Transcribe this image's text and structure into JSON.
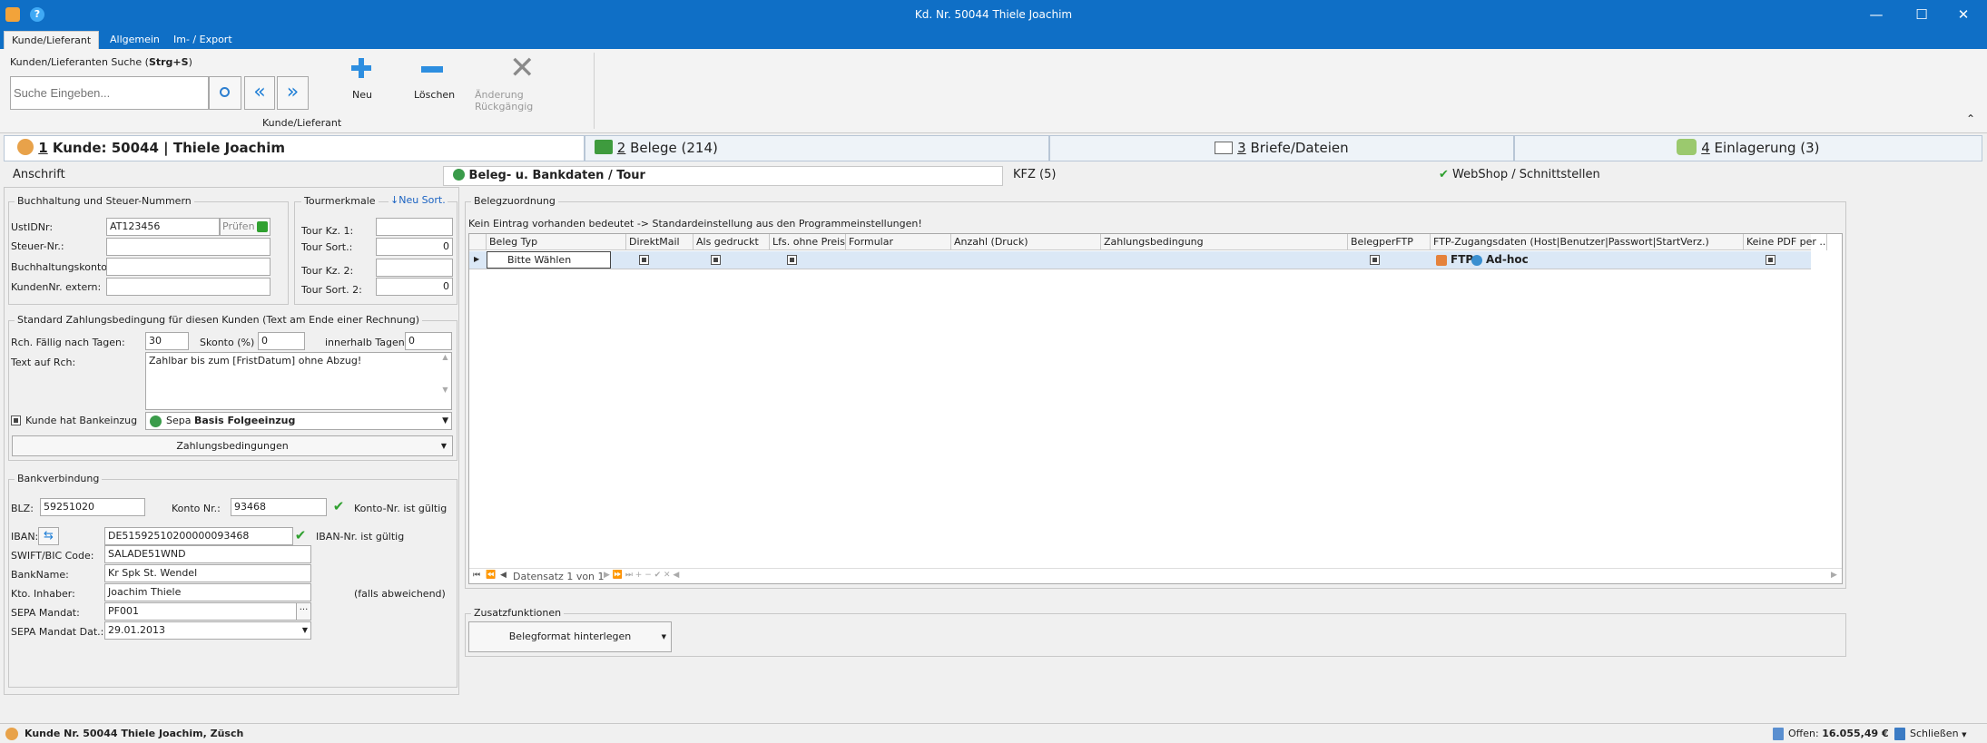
{
  "window": {
    "title": "Kd. Nr. 50044 Thiele Joachim",
    "minimize": "—",
    "maximize": "☐",
    "close": "✕",
    "help_icon": "?"
  },
  "ribbon_tabs": [
    "Kunde/Lieferant",
    "Allgemein",
    "Im- / Export"
  ],
  "ribbon": {
    "search_label_prefix": "Kunden/Lieferanten Suche (",
    "search_label_shortcut": "Strg+S",
    "search_label_suffix": ")",
    "search_placeholder": "Suche Eingeben...",
    "new_label": "Neu",
    "delete_label": "Löschen",
    "undo_label": "Änderung Rückgängig",
    "group_label": "Kunde/Lieferant",
    "collapse_icon": "⌃"
  },
  "main_tabs": [
    {
      "num": "1",
      "label": " Kunde: 50044 | Thiele Joachim"
    },
    {
      "num": "2",
      "label": " Belege (214)"
    },
    {
      "num": "3",
      "label": " Briefe/Dateien"
    },
    {
      "num": "4",
      "label": " Einlagerung (3)"
    }
  ],
  "sub_tabs": {
    "anschrift": "Anschrift",
    "beleg": "Beleg- u. Bankdaten / Tour",
    "kfz": "KFZ (5)",
    "webshop": "WebShop / Schnittstellen"
  },
  "buchhaltung": {
    "legend": "Buchhaltung und Steuer-Nummern",
    "ustid_label": "UstIDNr:",
    "ustid_value": "AT123456",
    "pruefen_label": "Prüfen",
    "steuer_label": "Steuer-Nr.:",
    "konto_label": "Buchhaltungskonto:",
    "kundennr_label": "KundenNr. extern:"
  },
  "tour": {
    "legend": "Tourmerkmale",
    "neu_sort": "Neu Sort.",
    "kz1_label": "Tour Kz. 1:",
    "sort1_label": "Tour Sort.:",
    "sort1_value": "0",
    "kz2_label": "Tour Kz. 2:",
    "sort2_label": "Tour Sort. 2:",
    "sort2_value": "0"
  },
  "zahlung": {
    "legend": "Standard Zahlungsbedingung für diesen Kunden (Text am Ende einer Rechnung)",
    "faellig_label": "Rch. Fällig nach Tagen:",
    "faellig_value": "30",
    "skonto_label": "Skonto (%)",
    "skonto_value": "0",
    "innerhalb_label": "innerhalb Tagen:",
    "innerhalb_value": "0",
    "text_label": "Text auf Rch:",
    "text_value": "Zahlbar bis zum [FristDatum] ohne Abzug!",
    "bankeinzug_label": "Kunde hat Bankeinzug",
    "sepa_prefix": "Sepa ",
    "sepa_bold": "Basis Folgeeinzug",
    "zb_button": "Zahlungsbedingungen"
  },
  "bank": {
    "legend": "Bankverbindung",
    "blz_label": "BLZ:",
    "blz_value": "59251020",
    "konto_label": "Konto Nr.:",
    "konto_value": "93468",
    "konto_valid": "Konto-Nr. ist gültig",
    "iban_label": "IBAN:",
    "iban_value": "DE51592510200000093468",
    "iban_valid": "IBAN-Nr. ist gültig",
    "swift_label": "SWIFT/BIC Code:",
    "swift_value": "SALADE51WND",
    "bankname_label": "BankName:",
    "bankname_value": "Kr Spk St. Wendel",
    "inhaber_label": "Kto. Inhaber:",
    "inhaber_value": "Joachim Thiele",
    "inhaber_note": "(falls abweichend)",
    "mandat_label": "SEPA Mandat:",
    "mandat_value": "PF001",
    "mandat_btn": "···",
    "mandat_dat_label": "SEPA Mandat Dat.:",
    "mandat_dat_value": "29.01.2013"
  },
  "belegzuordnung": {
    "legend": "Belegzuordnung",
    "info": "Kein Eintrag vorhanden bedeutet -> Standardeinstellung aus den Programmeinstellungen!",
    "columns": [
      "Beleg Typ",
      "DirektMail",
      "Als gedruckt",
      "Lfs. ohne Preis",
      "Formular",
      "Anzahl (Druck)",
      "Zahlungsbedingung",
      "BelegperFTP",
      "FTP-Zugangsdaten (Host|Benutzer|Passwort|StartVerz.)",
      "Keine PDF per ..."
    ],
    "row_typ": "Bitte Wählen",
    "row_ftp": "FTP",
    "row_adhoc": "Ad-hoc",
    "navigator": "Datensatz 1 von 1"
  },
  "zusatz": {
    "legend": "Zusatzfunktionen",
    "button": "Belegformat hinterlegen"
  },
  "statusbar": {
    "left": "Kunde Nr. 50044 Thiele Joachim, Züsch",
    "offen_label": "Offen: ",
    "offen_value": "16.055,49 €",
    "schliessen": "Schließen"
  },
  "colors": {
    "titlebar": "#0f6fc6",
    "accent_green": "#2fa02f",
    "grid_selected": "#dbe8f6"
  }
}
